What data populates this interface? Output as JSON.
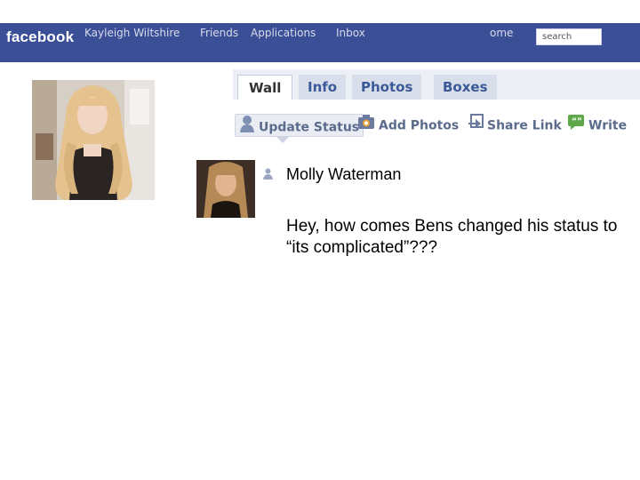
{
  "topbar": {
    "brand": "facebook",
    "user_name": "Kayleigh Wiltshire",
    "nav": {
      "friends": "Friends",
      "applications": "Applications",
      "inbox": "Inbox",
      "home": "ome"
    },
    "search_placeholder": "search"
  },
  "tabs": {
    "wall": "Wall",
    "info": "Info",
    "photos": "Photos",
    "boxes": "Boxes"
  },
  "actions": {
    "update_status": "Update Status",
    "add_photos": "Add Photos",
    "share_link": "Share Link",
    "write": "Write"
  },
  "post": {
    "author": "Molly Waterman",
    "text": "Hey, how comes Bens changed his status to “its complicated”???"
  },
  "colors": {
    "topbar": "#3b4f96",
    "tab_bg": "#d8dfea",
    "link": "#3b5998"
  }
}
